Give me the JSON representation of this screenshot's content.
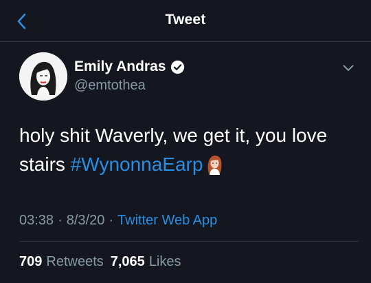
{
  "header": {
    "title": "Tweet",
    "back_icon": "chevron-left-icon"
  },
  "author": {
    "name": "Emily Andras",
    "handle": "@emtothea",
    "verified_icon": "verified-badge-icon"
  },
  "tweet": {
    "text_before": "holy shit Waverly, we get it, you love stairs ",
    "hashtag": "#WynonnaEarp",
    "emoji": "woman-red-hair-emoji"
  },
  "meta": {
    "time": "03:38",
    "separator": "·",
    "date": "8/3/20",
    "source": "Twitter Web App"
  },
  "stats": {
    "retweets_count": "709",
    "retweets_label": "Retweets",
    "likes_count": "7,065",
    "likes_label": "Likes"
  },
  "colors": {
    "background": "#14171f",
    "accent": "#2b8ee3",
    "secondary_text": "#8899a6",
    "divider": "#2f3642"
  }
}
